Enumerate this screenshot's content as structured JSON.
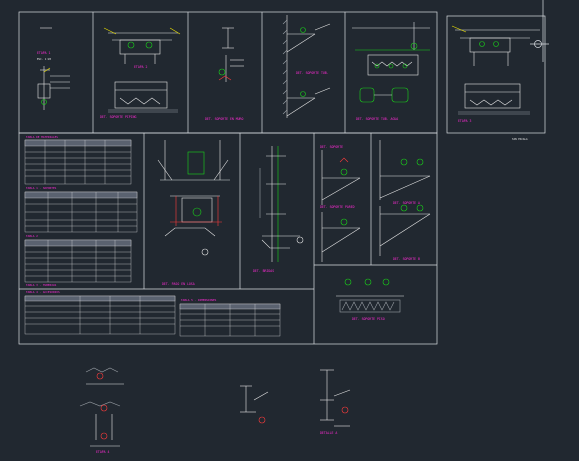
{
  "drawing": {
    "background": "#212830",
    "colors": {
      "frame": "#d9dde2",
      "linework": "#e6e6e6",
      "title_magenta": "#ff2bd6",
      "pipe_green": "#19d419",
      "annotation_yellow": "#f2e600",
      "hatch_grey": "#9aa0a6",
      "marker_red": "#ff3b3b",
      "table_header": "#5a6270"
    },
    "titles": {
      "t1": "ETAPA 1",
      "t2": "ETAPA 2",
      "t3": "DET. SOPORTE EN MURO",
      "t4": "DET. SOPORTE TUB.",
      "t5": "DET. SOPORTE TUB. AGUA",
      "t6": "DET. SOPORTE PIPING",
      "t7": "TABLA DE MATERIALES",
      "t8": "DET. PASO EN LOSA",
      "t9": "DET. BRIDAS",
      "t10": "DET. SOPORTE",
      "t11": "DET. SOPORTE PARED",
      "t12": "DET. SOPORTE A",
      "t13": "DET. SOPORTE B",
      "t14": "DET. SOPORTE PISO",
      "t15": "ETAPA 3",
      "t16": "ETAPA 4",
      "t17": "DETALLE A"
    },
    "scales": {
      "s": "ESC. 1:20"
    },
    "tables": {
      "table1_title": "TABLA 1 - SOPORTES",
      "table2_title": "TABLA 2",
      "table3_title": "TABLA 3 - TUBERIAS",
      "table4_title": "TABLA 4 - ACCESORIOS",
      "table5_title": "TABLA 5 - DIMENSIONES"
    },
    "ref_label": "SIN ESCALA"
  }
}
